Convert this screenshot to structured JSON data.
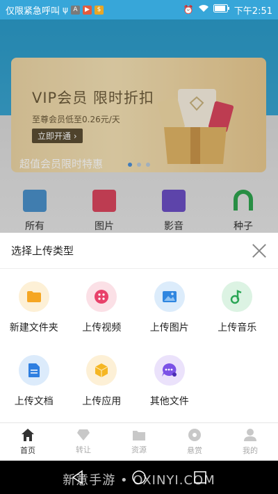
{
  "status_bar": {
    "carrier_text": "仅限紧急呼叫",
    "time": "下午2:51",
    "notif_icons": [
      "usb-icon",
      "android-icon",
      "play-icon",
      "app-icon"
    ]
  },
  "background": {
    "banner": {
      "title": "VIP会员 限时折扣",
      "subtitle": "至尊会员低至0.26元/天",
      "button_label": "立即开通 ›",
      "caption": "超值会员限时特惠"
    },
    "categories": [
      {
        "label": "所有",
        "icon": "file-icon",
        "color": "#4a90c9"
      },
      {
        "label": "图片",
        "icon": "image-icon",
        "color": "#d9465d"
      },
      {
        "label": "影音",
        "icon": "video-icon",
        "color": "#6b4fc4"
      },
      {
        "label": "种子",
        "icon": "torrent-icon",
        "color": "#2ea44f"
      }
    ]
  },
  "sheet": {
    "title": "选择上传类型",
    "options": [
      {
        "label": "新建文件夹",
        "icon": "folder-icon",
        "bg": "#fdf0d6",
        "color": "#f5a623"
      },
      {
        "label": "上传视频",
        "icon": "video-icon",
        "bg": "#fbe0e6",
        "color": "#e8416a"
      },
      {
        "label": "上传图片",
        "icon": "image-icon",
        "bg": "#dcecfb",
        "color": "#2f86e0"
      },
      {
        "label": "上传音乐",
        "icon": "music-icon",
        "bg": "#dcf3e3",
        "color": "#2aa655"
      },
      {
        "label": "上传文档",
        "icon": "document-icon",
        "bg": "#dcebfb",
        "color": "#2f7fe0"
      },
      {
        "label": "上传应用",
        "icon": "app-icon",
        "bg": "#fdf0d6",
        "color": "#f5b623"
      },
      {
        "label": "其他文件",
        "icon": "more-icon",
        "bg": "#ebe2fb",
        "color": "#7b52e6"
      }
    ]
  },
  "tabbar": {
    "tabs": [
      {
        "label": "首页",
        "icon": "home-icon",
        "active": true
      },
      {
        "label": "转让",
        "icon": "diamond-icon",
        "active": false
      },
      {
        "label": "资源",
        "icon": "folder-icon",
        "active": false
      },
      {
        "label": "悬赏",
        "icon": "reward-icon",
        "active": false
      },
      {
        "label": "我的",
        "icon": "user-icon",
        "active": false
      }
    ]
  },
  "watermark": "新意手游 • OXINYI.COM"
}
